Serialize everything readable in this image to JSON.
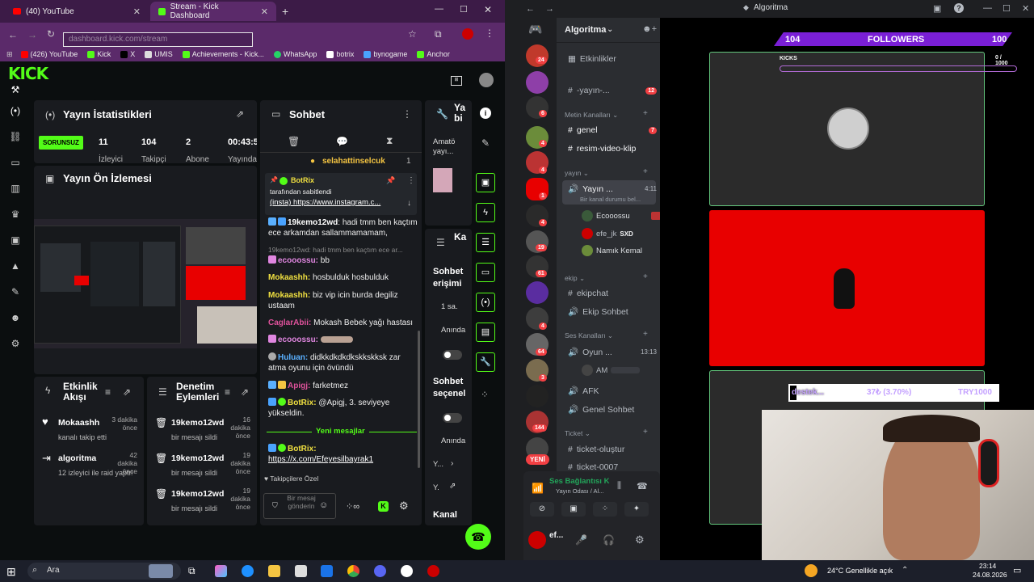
{
  "browser": {
    "tabs": [
      {
        "title": "(40) YouTube",
        "icon": "youtube-icon"
      },
      {
        "title": "Stream - Kick Dashboard",
        "icon": "kick-icon"
      }
    ],
    "url": "dashboard.kick.com/stream",
    "bookmarks": [
      "(426) YouTube",
      "Kick",
      "X",
      "UMIS",
      "Achievements - Kick...",
      "WhatsApp",
      "botrix",
      "bynogame",
      "Anchor"
    ]
  },
  "kick": {
    "logo": "KICK",
    "stats": {
      "title": "Yayın İstatistikleri",
      "status": "SORUNSUZ",
      "items": [
        {
          "value": "11",
          "label": "İzleyici"
        },
        {
          "value": "104",
          "label": "Takipçi"
        },
        {
          "value": "2",
          "label": "Abone"
        },
        {
          "value": "00:43:5",
          "label": "Yayında"
        }
      ]
    },
    "preview": {
      "title": "Yayın Ön İzlemesi"
    },
    "chat": {
      "title": "Sohbet",
      "top_user": "selahattinselcuk",
      "top_count": "1",
      "pinned": {
        "user": "BotRix",
        "by": "tarafından sabitlendi",
        "text": "(insta) https://www.instagram.c..."
      },
      "messages": [
        {
          "user": "19kemo12wd",
          "color": "#ffffff",
          "text": "hadi tmm ben kaçtım ece arkamdan sallammamamam,"
        },
        {
          "user": "",
          "color": "#888888",
          "text": "19kemo12wd: hadi tmm ben kaçtım ece ar..."
        },
        {
          "user": "ecooossu:",
          "color": "#e086e0",
          "text": "bb"
        },
        {
          "user": "Mokaashh:",
          "color": "#f0e040",
          "text": "hosbulduk hosbulduk"
        },
        {
          "user": "Mokaashh:",
          "color": "#f0e040",
          "text": "biz vip icin burda degiliz ustaam"
        },
        {
          "user": "CaglarAbii:",
          "color": "#e0529c",
          "text": "Mokash Bebek yağı hastası"
        },
        {
          "user": "ecooossu:",
          "color": "#e086e0",
          "text": ""
        },
        {
          "user": "Huluan:",
          "color": "#5ab0ff",
          "text": "didkkdkdkdkskkskksk zar atma oyunu için övündü"
        },
        {
          "user": "Apigj:",
          "color": "#e0529c",
          "text": "farketmez"
        },
        {
          "user": "BotRix:",
          "color": "#f0e040",
          "text": "@Apigj, 3. seviyeye yükseldin."
        }
      ],
      "new_messages": "Yeni mesajlar",
      "last": {
        "user": "BotRix:",
        "text": "https://x.com/Efeyesilbayrak1"
      },
      "followers_only": "Takipçilere Özel",
      "input_placeholder": "Bir mesaj gönderin"
    },
    "activity": {
      "title": "Etkinlik Akışı",
      "items": [
        {
          "user": "Mokaashh",
          "sub": "kanalı takip etti",
          "time": "3 dakika önce"
        },
        {
          "user": "algoritma",
          "sub": "12 izleyici ile raid yaptı!",
          "time": "42 dakika önce"
        }
      ]
    },
    "mod": {
      "title": "Denetim Eylemleri",
      "items": [
        {
          "user": "19kemo12wd",
          "sub": "bir mesajı sildi",
          "time": "16 dakika önce"
        },
        {
          "user": "19kemo12wd",
          "sub": "bir mesajı sildi",
          "time": "19 dakika önce"
        },
        {
          "user": "19kemo12wd",
          "sub": "bir mesajı sildi",
          "time": "19 dakika önce"
        }
      ]
    },
    "right": {
      "col_title": "Ya bi",
      "amato": "Amatö yayı...",
      "ka": "Ka",
      "sohbet_erisimi": "Sohbet erişimi",
      "one_sa": "1 sa.",
      "aninda1": "Anında",
      "sohbet_secenek": "Sohbet seçenel",
      "aninda2": "Anında",
      "y1": "Y...",
      "y2": "Y.",
      "kanal": "Kanal"
    }
  },
  "discord": {
    "title": "Algoritma",
    "server": "Algoritma",
    "categories": {
      "metin": "Metin Kanalları",
      "yayin": "yayın",
      "ekip": "ekip",
      "ses": "Ses Kanalları",
      "ticket": "Ticket"
    },
    "channels": {
      "yayin_top": "-yayın-...",
      "genel": "genel",
      "resim": "resim-video-klip",
      "yayin_voice": "Yayın ...",
      "yayin_voice_time": "4:11",
      "yayin_voice_sub": "Bir kanal durumu bel...",
      "ekipchat": "ekipchat",
      "ekip_sohbet": "Ekip Sohbet",
      "oyun": "Oyun ...",
      "oyun_time": "13:13",
      "afk": "AFK",
      "genel_sohbet": "Genel Sohbet",
      "ticket_olustur": "ticket-oluştur",
      "ticket_0007": "ticket-0007"
    },
    "voice_users": [
      "Ecooossu",
      "efe_jk",
      "Namık Kemal"
    ],
    "voice_user_tag": "SXD",
    "oyun_user": "AM",
    "badges": {
      "yayin": "12",
      "genel": "7"
    },
    "server_badges": [
      "24",
      "4",
      "6",
      "4",
      "4",
      "3",
      "1",
      "19",
      "61",
      "4",
      "64",
      "144"
    ],
    "new_label": "YENİ",
    "voice_status": "Ses Bağlantısı K",
    "voice_room": "Yayın Odası / Al...",
    "me": "ef..."
  },
  "overlay": {
    "followers_left": "104",
    "followers_label": "FOLLOWERS",
    "followers_right": "100",
    "kicks_label": "KICKS",
    "kicks_value": "0 / 1000",
    "destek_label": "destek...",
    "destek_pct": "37₺ (3.70%)",
    "destek_goal": "TRY1000"
  },
  "taskbar": {
    "search": "Ara",
    "weather": "24°C  Genellikle açık",
    "time": "23:14",
    "date": "24.08.2026"
  }
}
